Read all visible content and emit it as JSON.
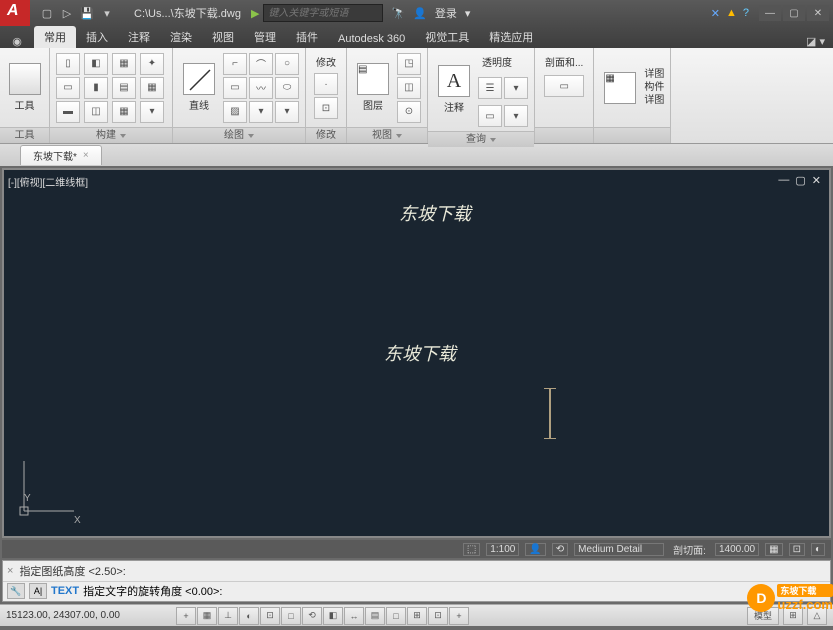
{
  "title": {
    "path": "C:\\Us...\\东坡下载.dwg",
    "search_placeholder": "键入关键字或短语",
    "login": "登录"
  },
  "qat": [
    "new",
    "open",
    "save",
    "dropdown"
  ],
  "ribbon_tabs": [
    "常用",
    "插入",
    "注释",
    "渲染",
    "视图",
    "管理",
    "插件",
    "Autodesk 360",
    "视觉工具",
    "精选应用"
  ],
  "ribbon_active": 0,
  "panels": {
    "tools": {
      "label": "工具",
      "big": "工具"
    },
    "build": {
      "label": "构建"
    },
    "draw": {
      "label": "绘图",
      "big": "直线"
    },
    "modify": {
      "label": "修改",
      "big": "修改"
    },
    "view": {
      "label": "视图",
      "big": "图层"
    },
    "annotate": {
      "label": "注释",
      "big": "注释",
      "extra": "透明度"
    },
    "query": {
      "label": "查询"
    },
    "section": {
      "label": "剖面和..."
    },
    "detail": {
      "label": "详图",
      "l1": "详图",
      "l2": "构件",
      "l3": "详图"
    }
  },
  "drawing_tab": "东坡下载*",
  "viewport": {
    "label": "[-][俯视][二维线框]",
    "text1": "东坡下载",
    "text2": "东坡下载",
    "ucs_y": "Y",
    "ucs_x": "X"
  },
  "vp_status": {
    "scale_icon": "⬚",
    "scale": "1:100",
    "people": "👤",
    "nav": "⟲",
    "detail": "Medium Detail",
    "section_label": "剖切面:",
    "section_val": "1400.00"
  },
  "cmd": {
    "line1": "指定图纸高度 <2.50>:",
    "line2_prefix": "A|",
    "line2_cmd": "TEXT",
    "line2_rest": "指定文字的旋转角度 <0.00>:"
  },
  "status": {
    "coords": "15123.00, 24307.00, 0.00",
    "btns": [
      "+",
      "▦",
      "⊥",
      "◐",
      "⊡",
      "□",
      "⟲",
      "◧",
      "↔",
      "▤",
      "□",
      "⊞",
      "⊡",
      "+"
    ],
    "model": "模型",
    "layout": "⊞",
    "ann": "△"
  },
  "watermark": "uzzf.com",
  "watermark_label": "东坡下载"
}
